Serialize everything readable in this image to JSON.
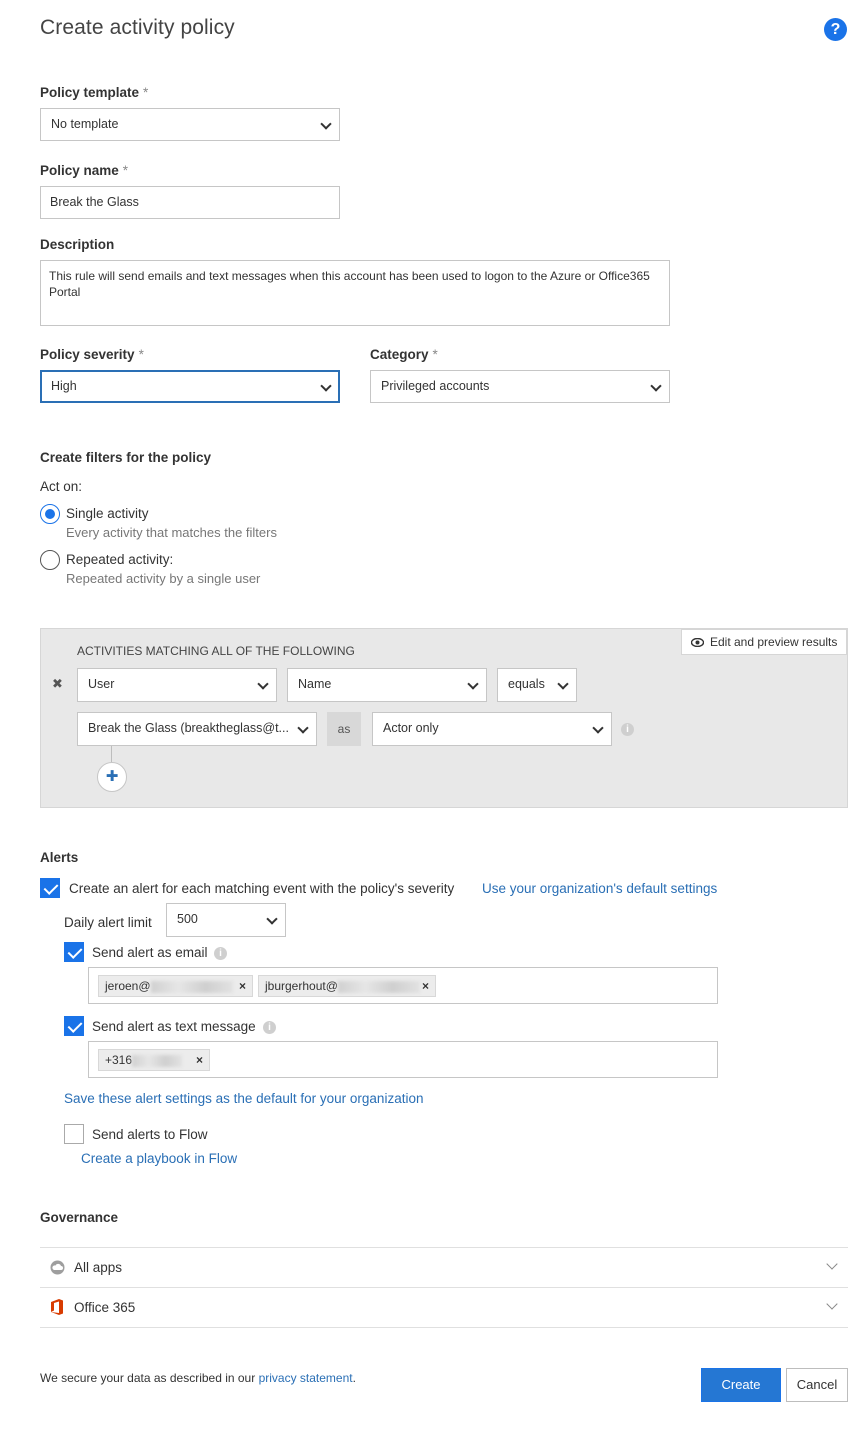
{
  "page": {
    "title": "Create activity policy",
    "help_icon": "?"
  },
  "policy_template": {
    "label": "Policy template",
    "required": "*",
    "value": "No template"
  },
  "policy_name": {
    "label": "Policy name",
    "required": "*",
    "value": "Break the Glass"
  },
  "description": {
    "label": "Description",
    "value": "This rule will send emails and text messages when this account has been used to logon to the Azure or Office365 Portal"
  },
  "policy_severity": {
    "label": "Policy severity",
    "required": "*",
    "value": "High"
  },
  "category": {
    "label": "Category",
    "required": "*",
    "value": "Privileged accounts"
  },
  "filters": {
    "heading": "Create filters for the policy",
    "act_on": "Act on:",
    "options": [
      {
        "label": "Single activity",
        "sub": "Every activity that matches the filters",
        "selected": true
      },
      {
        "label": "Repeated activity:",
        "sub": "Repeated activity by a single user",
        "selected": false
      }
    ],
    "box_title": "ACTIVITIES MATCHING ALL OF THE FOLLOWING",
    "edit_preview": "Edit and preview results",
    "remove_glyph": "✖",
    "row1": {
      "field": "User",
      "attribute": "Name",
      "operator": "equals"
    },
    "row2": {
      "value": "Break the Glass (breaktheglass@t...",
      "as": "as",
      "role": "Actor only"
    },
    "add_glyph": "✚"
  },
  "alerts": {
    "heading": "Alerts",
    "create_alert": {
      "label": "Create an alert for each matching event with the policy's severity",
      "checked": true
    },
    "default_settings_link": "Use your organization's default settings",
    "daily_limit": {
      "label": "Daily alert limit",
      "value": "500"
    },
    "send_email": {
      "label": "Send alert as email",
      "checked": true
    },
    "email_tags": [
      "jeroen@",
      "jburgerhout@"
    ],
    "send_text": {
      "label": "Send alert as text message",
      "checked": true
    },
    "phone_tags": [
      "+316"
    ],
    "tag_remove": "×",
    "save_default_link": "Save these alert settings as the default for your organization",
    "send_flow": {
      "label": "Send alerts to Flow",
      "checked": false
    },
    "playbook_link": "Create a playbook in Flow"
  },
  "governance": {
    "heading": "Governance",
    "items": [
      {
        "label": "All apps",
        "icon": "cloud-icon"
      },
      {
        "label": "Office 365",
        "icon": "office-icon"
      }
    ]
  },
  "footer": {
    "text": "We secure your data as described in our ",
    "privacy_link": "privacy statement",
    "period": ".",
    "create": "Create",
    "cancel": "Cancel"
  },
  "colors": {
    "accent": "#1a73e8",
    "link": "#2a6fb5",
    "office": "#d83b01"
  }
}
